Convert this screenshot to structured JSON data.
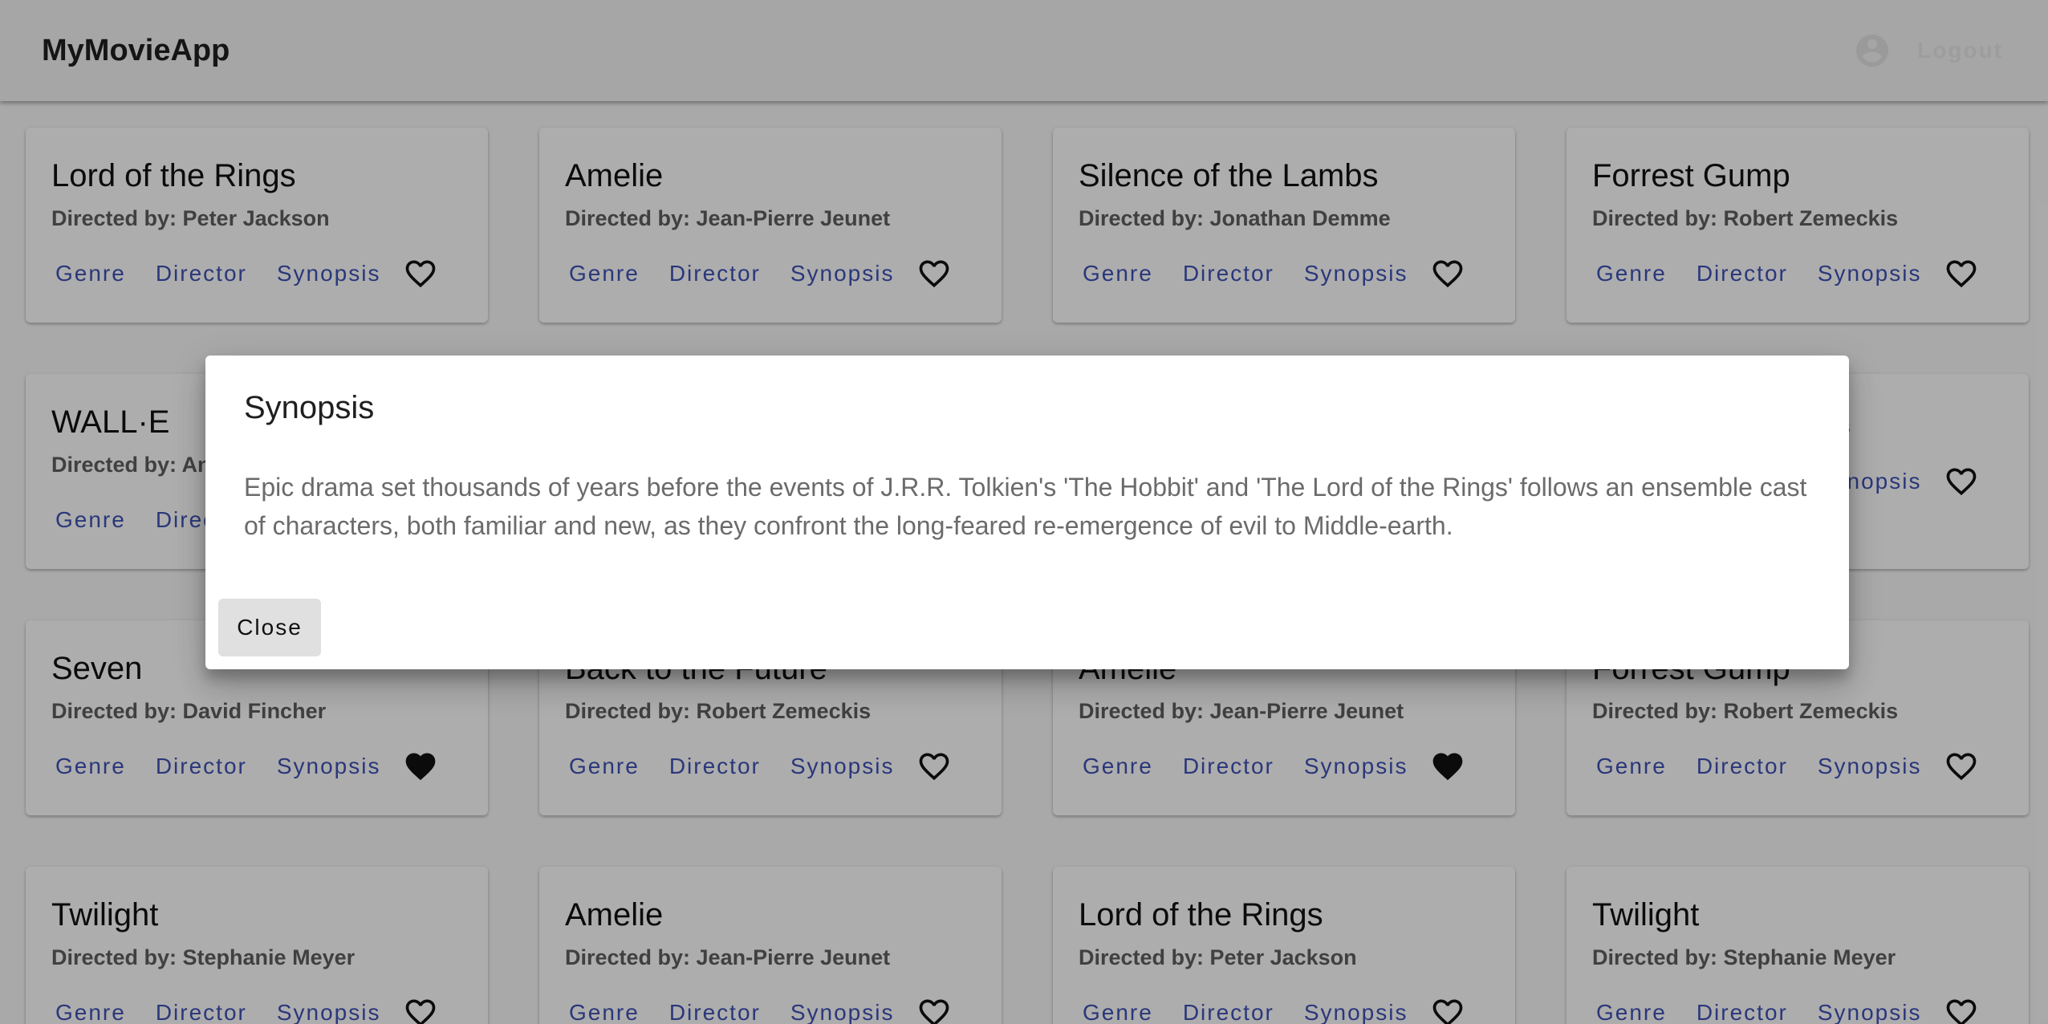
{
  "app": {
    "title": "MyMovieApp",
    "logout_label": "Logout"
  },
  "card_actions": {
    "genre": "Genre",
    "director": "Director",
    "synopsis": "Synopsis"
  },
  "movies": [
    {
      "title": "Lord of the Rings",
      "director": "Directed by: Peter Jackson",
      "favorite": false
    },
    {
      "title": "Amelie",
      "director": "Directed by: Jean-Pierre Jeunet",
      "favorite": false
    },
    {
      "title": "Silence of the Lambs",
      "director": "Directed by: Jonathan Demme",
      "favorite": false
    },
    {
      "title": "Forrest Gump",
      "director": "Directed by: Robert Zemeckis",
      "favorite": false
    },
    {
      "title": "WALL·E",
      "director": "Directed by: An",
      "favorite": false
    },
    {
      "title": "",
      "director": "",
      "favorite": false
    },
    {
      "title": "",
      "director": "",
      "favorite": false
    },
    {
      "title": "",
      "director": "s",
      "favorite": false
    },
    {
      "title": "Seven",
      "director": "Directed by: David Fincher",
      "favorite": true
    },
    {
      "title": "Back to the Future",
      "director": "Directed by: Robert Zemeckis",
      "favorite": false
    },
    {
      "title": "Amelie",
      "director": "Directed by: Jean-Pierre Jeunet",
      "favorite": true
    },
    {
      "title": "Forrest Gump",
      "director": "Directed by: Robert Zemeckis",
      "favorite": false
    },
    {
      "title": "Twilight",
      "director": "Directed by: Stephanie Meyer",
      "favorite": false
    },
    {
      "title": "Amelie",
      "director": "Directed by: Jean-Pierre Jeunet",
      "favorite": false
    },
    {
      "title": "Lord of the Rings",
      "director": "Directed by: Peter Jackson",
      "favorite": false
    },
    {
      "title": "Twilight",
      "director": "Directed by: Stephanie Meyer",
      "favorite": false
    }
  ],
  "dialog": {
    "title": "Synopsis",
    "body": "Epic drama set thousands of years before the events of J.R.R. Tolkien's 'The Hobbit' and 'The Lord of the Rings' follows an ensemble cast of characters, both familiar and new, as they confront the long-feared re-emergence of evil to Middle-earth.",
    "close_label": "Close"
  },
  "colors": {
    "accent": "#3f51b5",
    "backdrop": "rgba(0,0,0,0.32)"
  },
  "icons": {
    "user": "account-circle-icon",
    "favorite_outline": "heart-outline-icon",
    "favorite_filled": "heart-filled-icon"
  }
}
